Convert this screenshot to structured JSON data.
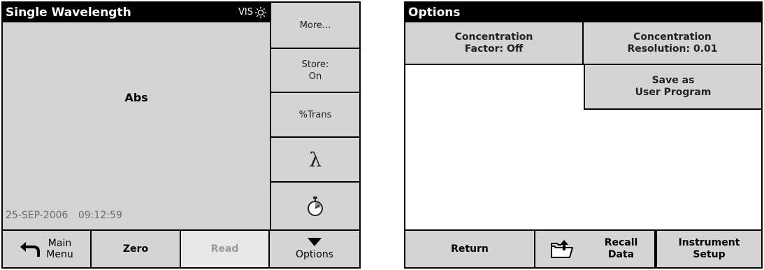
{
  "left_panel": {
    "title": "Single Wavelength",
    "source": "VIS",
    "source_icon": "sun-icon",
    "unit": "Abs",
    "date": "25-SEP-2006",
    "time": "09:12:59",
    "side_buttons": {
      "more": "More...",
      "store_line1": "Store:",
      "store_line2": "On",
      "trans": "%Trans",
      "lambda": "λ",
      "timer_icon": "stopwatch-icon"
    },
    "bottom_buttons": {
      "main_line1": "Main",
      "main_line2": "Menu",
      "main_icon": "return-arrow-icon",
      "zero": "Zero",
      "read": "Read",
      "options": "Options",
      "options_icon": "triangle-down-icon"
    }
  },
  "right_panel": {
    "title": "Options",
    "buttons": {
      "conc_factor_line1": "Concentration",
      "conc_factor_line2": "Factor: Off",
      "conc_res_line1": "Concentration",
      "conc_res_line2": "Resolution: 0.01",
      "save_line1": "Save as",
      "save_line2": "User Program"
    },
    "bottom_buttons": {
      "return": "Return",
      "export_icon": "folder-export-icon",
      "recall_line1": "Recall",
      "recall_line2": "Data",
      "instrument_line1": "Instrument",
      "instrument_line2": "Setup"
    }
  },
  "colors": {
    "button_gray": "#d4d4d4",
    "disabled_text": "#9a9a9a",
    "date_text": "#6b6b6b"
  }
}
